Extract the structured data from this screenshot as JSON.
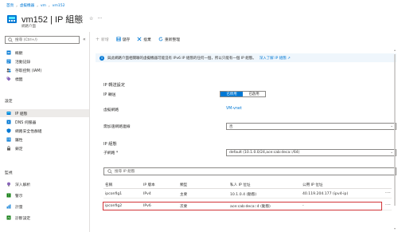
{
  "breadcrumb": [
    "首頁",
    "虛擬機器",
    "vm",
    "vm152"
  ],
  "header": {
    "title": "vm152 | IP 組態",
    "subtitle": "網路介面"
  },
  "sidebar": {
    "search_placeholder": "搜尋 (Ctrl+/)",
    "collapse": "«",
    "items_top": [
      {
        "label": "概觀",
        "icon": "overview-icon",
        "color": "#0078d4"
      },
      {
        "label": "活動記錄",
        "icon": "activity-log-icon",
        "color": "#0078d4"
      },
      {
        "label": "存取控制 (IAM)",
        "icon": "access-control-icon",
        "color": "#605e5c"
      },
      {
        "label": "標籤",
        "icon": "tag-icon",
        "color": "#8764b8"
      }
    ],
    "section_settings": "設定",
    "items_settings": [
      {
        "label": "IP 組態",
        "icon": "ip-config-icon",
        "color": "#0078d4",
        "active": true
      },
      {
        "label": "DNS 伺服器",
        "icon": "dns-icon",
        "color": "#0078d4"
      },
      {
        "label": "網路安全性群組",
        "icon": "nsg-icon",
        "color": "#0078d4"
      },
      {
        "label": "屬性",
        "icon": "properties-icon",
        "color": "#0078d4"
      },
      {
        "label": "鎖定",
        "icon": "lock-icon",
        "color": "#605e5c"
      }
    ],
    "section_monitor": "監視",
    "items_monitor": [
      {
        "label": "深入解析",
        "icon": "insights-icon",
        "color": "#8764b8"
      },
      {
        "label": "警示",
        "icon": "alerts-icon",
        "color": "#107c10"
      },
      {
        "label": "計量",
        "icon": "metrics-icon",
        "color": "#0078d4"
      },
      {
        "label": "診斷設定",
        "icon": "diagnostic-icon",
        "color": "#107c10"
      }
    ]
  },
  "toolbar": {
    "add": "新增",
    "save": "儲存",
    "discard": "捨棄",
    "refresh": "重新整理"
  },
  "banner": {
    "text": "與此網路介面相關聯的虛擬機器可能沒有 IPv6 IP 組態的任何一個，所以只能有一個 IP 組態。",
    "link": "深入了解 IP 組態 ↗"
  },
  "form": {
    "ip_forwarding_heading": "IP 轉送設定",
    "ip_forwarding_label": "IP 轉送",
    "toggle_on": "已停用",
    "toggle_off": "已啟用",
    "vnet_label": "虛擬網路",
    "vnet_value": "VM-vnet",
    "accelerated_label": "需加速網路連線",
    "accelerated_value": "否",
    "ip_config_heading": "IP 組態",
    "subnet_label": "子網路 *",
    "subnet_value": "default (10.1.0.0/24,ace:cab:deca::/64)"
  },
  "table": {
    "search_placeholder": "搜尋 IP 組態",
    "columns": [
      "名稱",
      "IP 版本",
      "類型",
      "私人 IP 位址",
      "公用 IP 位址"
    ],
    "rows": [
      {
        "name": "ipconfig1",
        "version": "IPv4",
        "type": "主要",
        "private_ip": "10.1.0.4 (動態)",
        "public_ip": "40.119.204.177 (ipv4-ip)"
      },
      {
        "name": "ipconfig2",
        "version": "IPv6",
        "type": "次要",
        "private_ip": "ace:cab:deca::4 (動態)",
        "public_ip": "-"
      }
    ],
    "more": "···"
  },
  "colors": {
    "accent": "#0078d4",
    "highlight": "#d13438"
  }
}
